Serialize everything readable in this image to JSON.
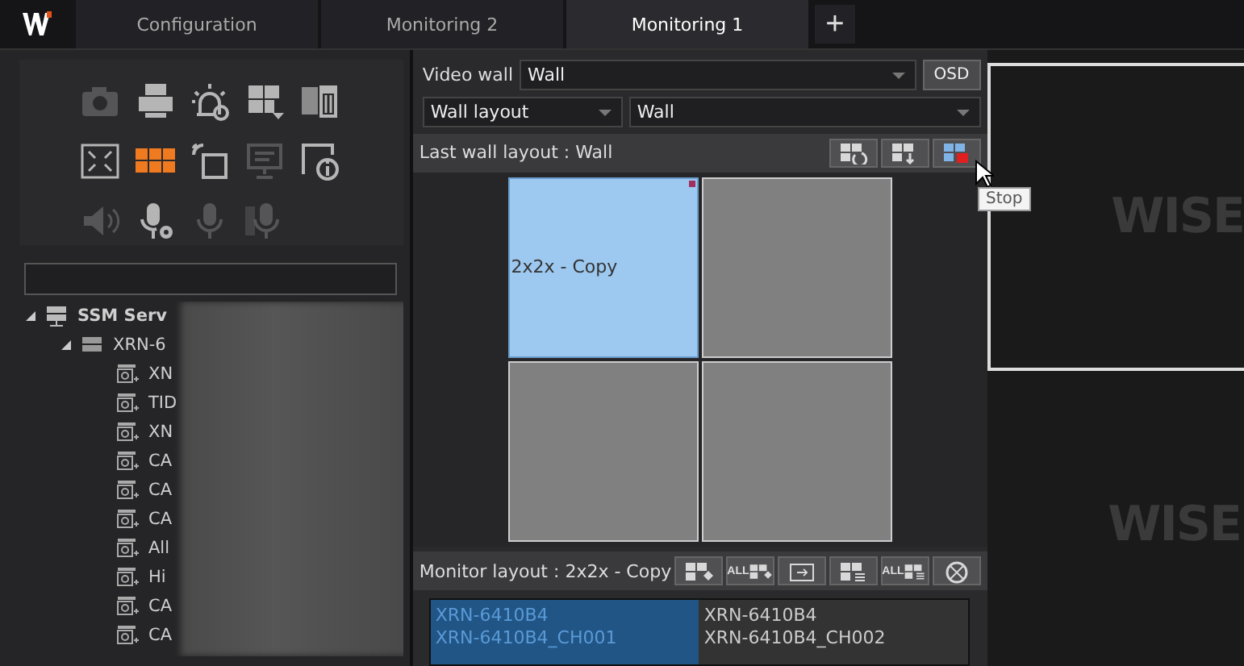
{
  "tabs": [
    {
      "label": "Configuration",
      "selected": false
    },
    {
      "label": "Monitoring 2",
      "selected": false
    },
    {
      "label": "Monitoring 1",
      "selected": true
    }
  ],
  "add_tab": "+",
  "tools": [
    {
      "kind": "camera",
      "disabled": true,
      "selected": false
    },
    {
      "kind": "printer",
      "disabled": false,
      "selected": false
    },
    {
      "kind": "alarm",
      "disabled": false,
      "selected": false
    },
    {
      "kind": "layout-menu",
      "disabled": false,
      "selected": false
    },
    {
      "kind": "delete-layout",
      "disabled": false,
      "selected": false
    },
    {
      "kind": "fullscreen",
      "disabled": false,
      "selected": false
    },
    {
      "kind": "grid",
      "disabled": false,
      "selected": true
    },
    {
      "kind": "popup",
      "disabled": false,
      "selected": false
    },
    {
      "kind": "monitor",
      "disabled": true,
      "selected": false
    },
    {
      "kind": "info",
      "disabled": false,
      "selected": false
    },
    {
      "kind": "speaker",
      "disabled": true,
      "selected": false
    },
    {
      "kind": "mic-settings",
      "disabled": false,
      "selected": false
    },
    {
      "kind": "mic",
      "disabled": true,
      "selected": false
    },
    {
      "kind": "mic-grid",
      "disabled": true,
      "selected": false
    }
  ],
  "tree": [
    {
      "label": "SSM Serv",
      "kind": "server",
      "expanded": true,
      "children": [
        {
          "label": "XRN-6",
          "kind": "recorder",
          "expanded": true,
          "children": [
            {
              "label": "XN",
              "kind": "camera"
            },
            {
              "label": "TID",
              "kind": "camera"
            },
            {
              "label": "XN",
              "kind": "camera"
            },
            {
              "label": "CA",
              "kind": "camera"
            },
            {
              "label": "CA",
              "kind": "camera"
            },
            {
              "label": "CA",
              "kind": "camera"
            },
            {
              "label": "All",
              "kind": "camera"
            },
            {
              "label": "Hi",
              "kind": "camera"
            },
            {
              "label": "CA",
              "kind": "camera"
            },
            {
              "label": "CA",
              "kind": "camera"
            }
          ]
        }
      ]
    }
  ],
  "video_wall": {
    "label": "Video wall",
    "value": "Wall",
    "osd_button": "OSD"
  },
  "wall_layout": {
    "mode": "Wall layout",
    "value": "Wall"
  },
  "last_wall_layout": "Last wall layout : Wall",
  "wall_buttons": [
    {
      "kind": "restore"
    },
    {
      "kind": "save"
    },
    {
      "kind": "stop"
    }
  ],
  "tooltip": "Stop",
  "wall_cells": [
    {
      "label": "2x2x - Copy",
      "selected": true
    },
    {
      "selected": false
    },
    {
      "selected": false
    },
    {
      "selected": false
    }
  ],
  "monitor_layout": "Monitor layout : 2x2x - Copy",
  "monitor_buttons": [
    {
      "kind": "assign"
    },
    {
      "kind": "assign-all",
      "label": "ALL"
    },
    {
      "kind": "swap"
    },
    {
      "kind": "clear"
    },
    {
      "kind": "clear-all",
      "label": "ALL"
    },
    {
      "kind": "reset"
    }
  ],
  "channels": [
    {
      "device": "XRN-6410B4",
      "channel": "XRN-6410B4_CH001",
      "selected": true
    },
    {
      "device": "XRN-6410B4",
      "channel": "XRN-6410B4_CH002",
      "selected": false
    }
  ],
  "viewports": [
    {
      "logo": "WISE",
      "selected": true
    },
    {
      "logo": "WISE",
      "selected": false
    }
  ]
}
